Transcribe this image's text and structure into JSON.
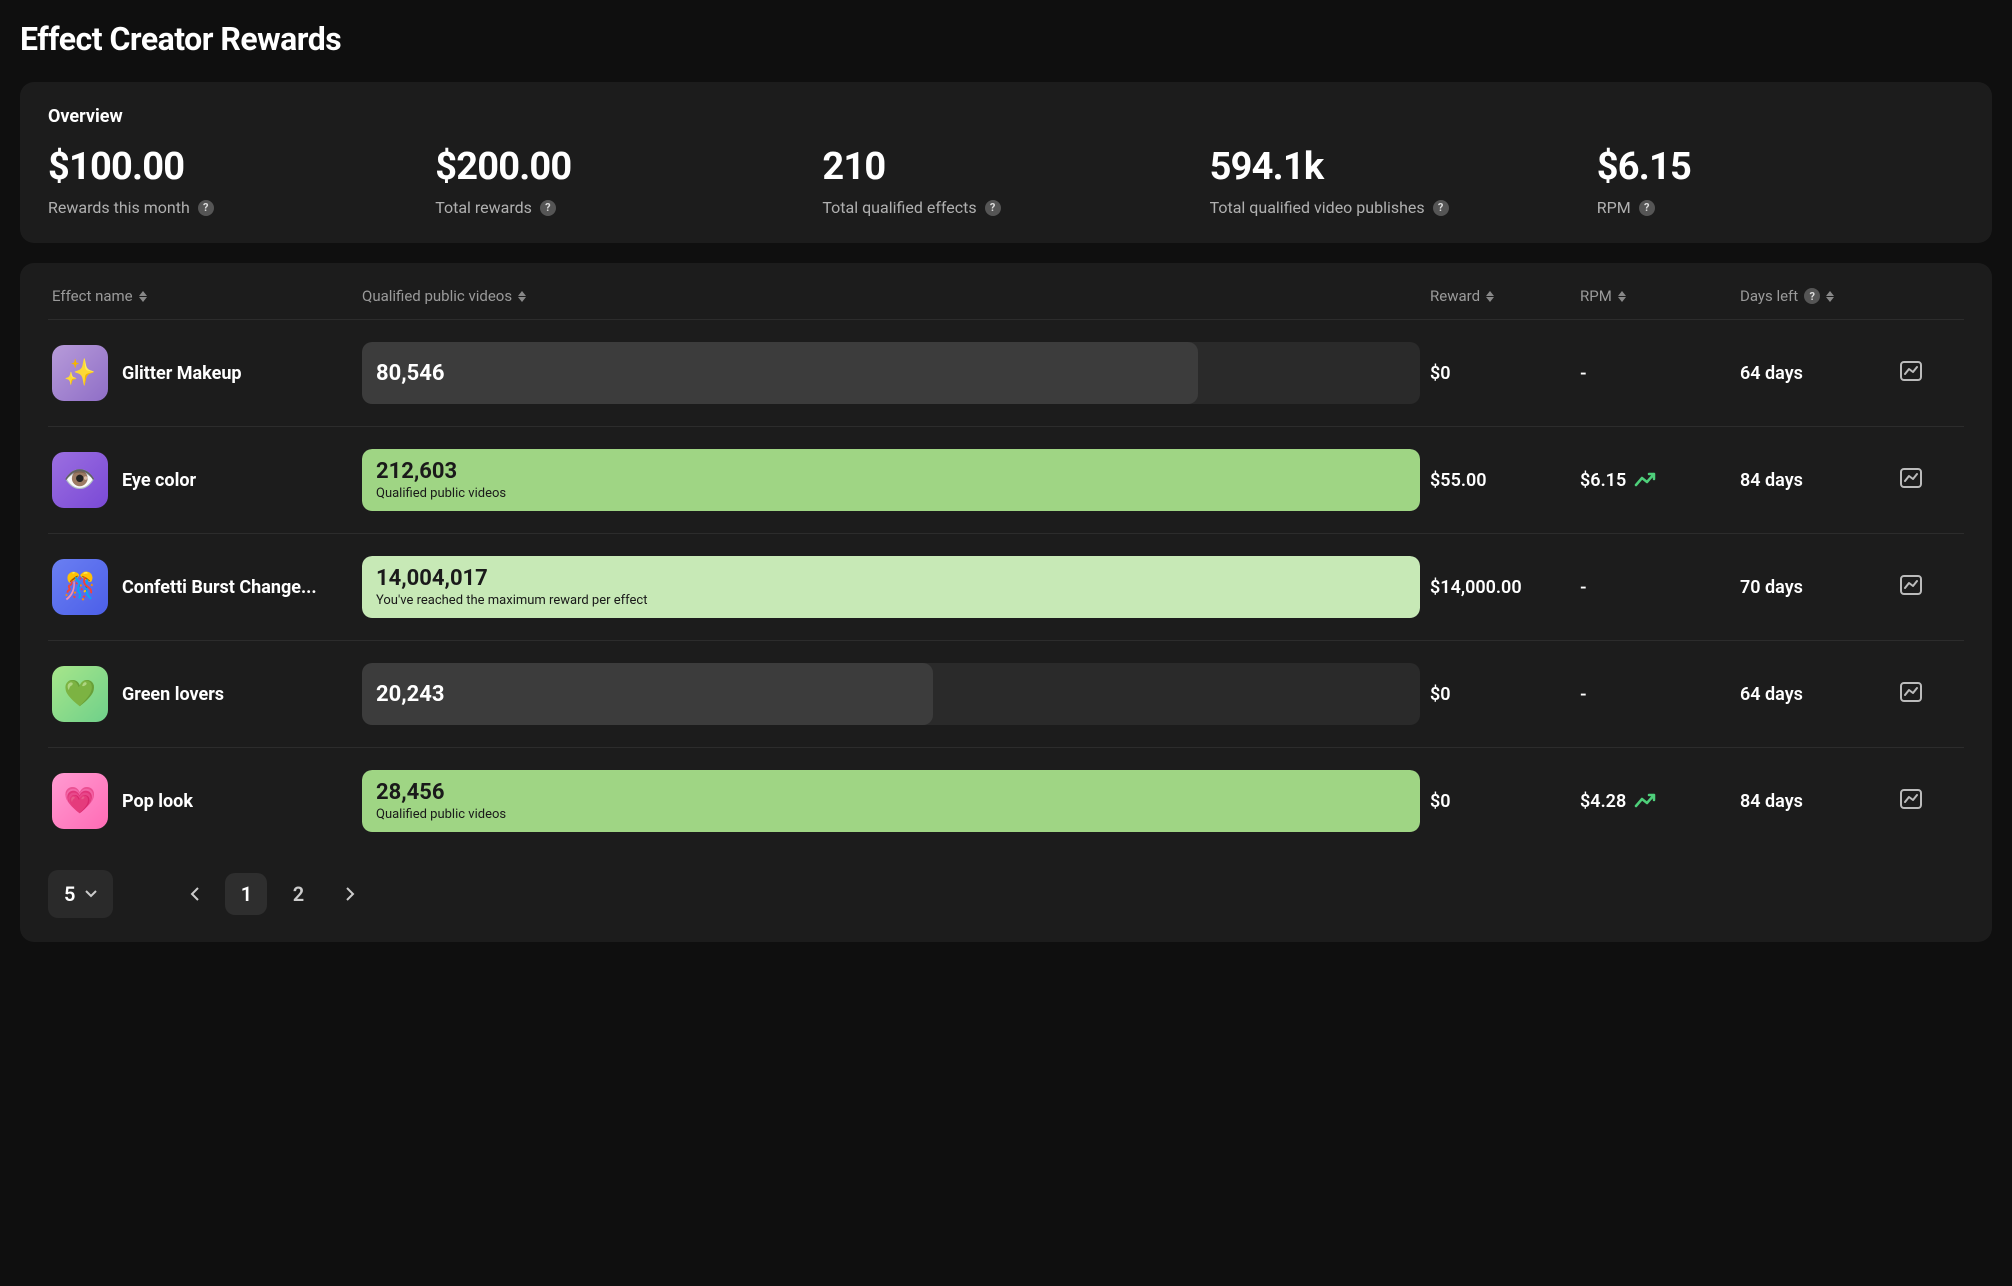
{
  "page_title": "Effect Creator Rewards",
  "overview": {
    "title": "Overview",
    "stats": [
      {
        "value": "$100.00",
        "label": "Rewards this month"
      },
      {
        "value": "$200.00",
        "label": "Total rewards"
      },
      {
        "value": "210",
        "label": "Total qualified effects"
      },
      {
        "value": "594.1k",
        "label": "Total qualified video publishes"
      },
      {
        "value": "$6.15",
        "label": "RPM"
      }
    ]
  },
  "columns": {
    "effect_name": "Effect name",
    "qualified_public_videos": "Qualified public videos",
    "reward": "Reward",
    "rpm": "RPM",
    "days_left": "Days left"
  },
  "rows": [
    {
      "name": "Glitter Makeup",
      "videos_value": "80,546",
      "videos_sub": "",
      "reward": "$0",
      "rpm": "-",
      "trend": false,
      "days_left": "64 days",
      "bar_style": "gray",
      "bar_pct": 79,
      "dark_text": false,
      "icon_bg": "linear-gradient(135deg,#b79bd9,#8f6ec7)",
      "icon_glyph": "✨"
    },
    {
      "name": "Eye color",
      "videos_value": "212,603",
      "videos_sub": "Qualified public videos",
      "reward": "$55.00",
      "rpm": "$6.15",
      "trend": true,
      "days_left": "84 days",
      "bar_style": "green",
      "bar_pct": 100,
      "dark_text": true,
      "icon_bg": "linear-gradient(135deg,#9b6fe0,#7a49d6)",
      "icon_glyph": "👁️"
    },
    {
      "name": "Confetti Burst Change...",
      "videos_value": "14,004,017",
      "videos_sub": "You've reached the maximum reward per effect",
      "reward": "$14,000.00",
      "rpm": "-",
      "trend": false,
      "days_left": "70 days",
      "bar_style": "green-light",
      "bar_pct": 100,
      "dark_text": true,
      "icon_bg": "linear-gradient(135deg,#6a7ff2,#4c5fe8)",
      "icon_glyph": "🎊"
    },
    {
      "name": "Green lovers",
      "videos_value": "20,243",
      "videos_sub": "",
      "reward": "$0",
      "rpm": "-",
      "trend": false,
      "days_left": "64 days",
      "bar_style": "gray",
      "bar_pct": 54,
      "dark_text": false,
      "icon_bg": "linear-gradient(135deg,#a7e68a,#6fd08a)",
      "icon_glyph": "💚"
    },
    {
      "name": "Pop look",
      "videos_value": "28,456",
      "videos_sub": "Qualified public videos",
      "reward": "$0",
      "rpm": "$4.28",
      "trend": true,
      "days_left": "84 days",
      "bar_style": "green",
      "bar_pct": 100,
      "dark_text": true,
      "icon_bg": "linear-gradient(135deg,#ff9bd1,#ff6bb5)",
      "icon_glyph": "💗"
    }
  ],
  "pagination": {
    "page_size": "5",
    "pages": [
      "1",
      "2"
    ],
    "current": "1"
  }
}
